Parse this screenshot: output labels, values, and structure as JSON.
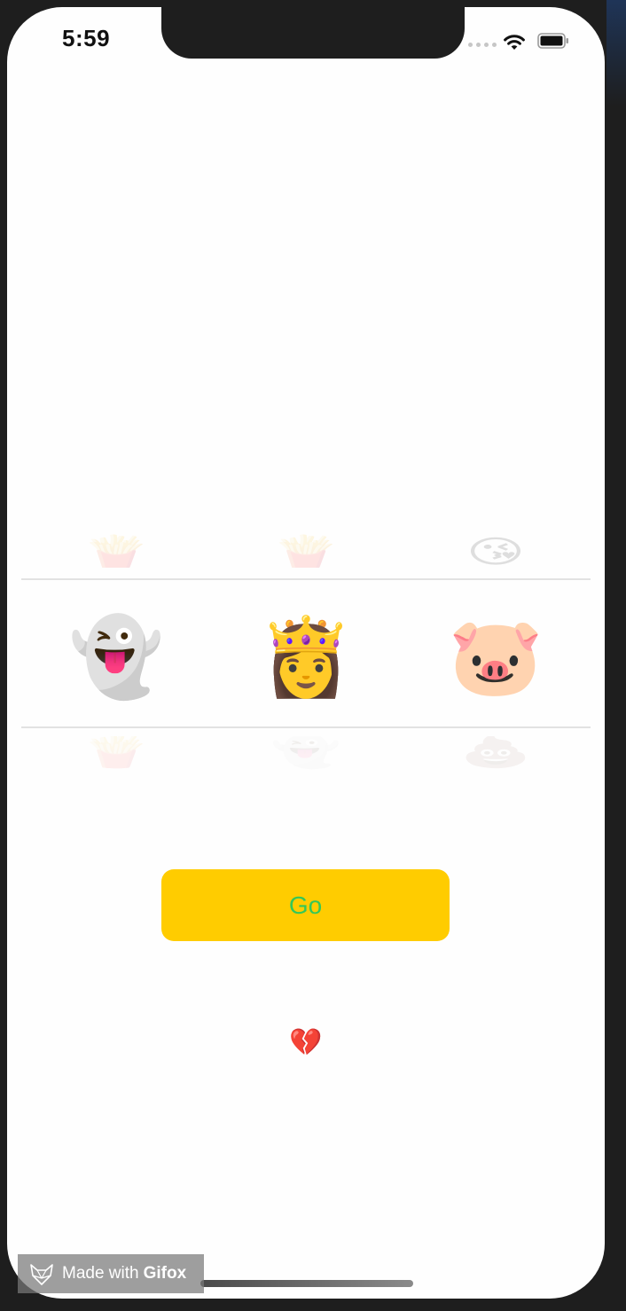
{
  "status_bar": {
    "time": "5:59",
    "signal_icon": "cellular-signal-icon",
    "wifi_icon": "wifi-icon",
    "battery_icon": "battery-icon"
  },
  "picker": {
    "columns": 3,
    "row_above": [
      "🍟",
      "🍟",
      "😘"
    ],
    "selected_row": [
      "👻",
      "👸",
      "🐷"
    ],
    "row_below": [
      "🍟",
      "👻",
      "💩"
    ]
  },
  "go_button": {
    "label": "Go",
    "background": "#ffcc00",
    "text_color": "#34c759"
  },
  "result": {
    "text": "💔"
  },
  "watermark": {
    "made_text": "Made with",
    "brand_text": "Gifox",
    "icon": "fox-icon"
  }
}
